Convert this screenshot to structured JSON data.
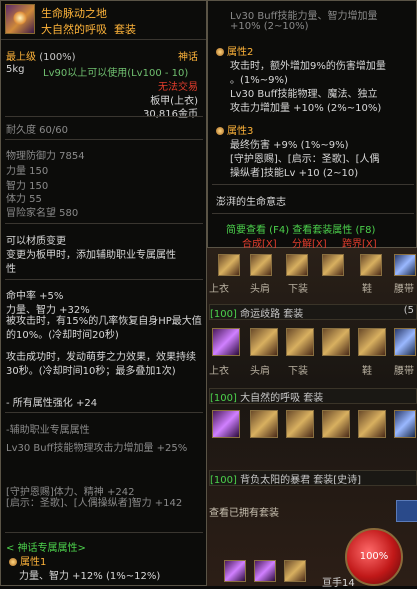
{
  "item": {
    "name": "生命脉动之地",
    "set_name": "大自然的呼吸",
    "set_tag": "套装",
    "max_level": "最上级",
    "max_level_pct": "(100%)",
    "rarity": "神话",
    "weight": "5kg",
    "level_req": "Lv90以上可以使用(Lv100 - 10)",
    "untradeable": "无法交易",
    "slot_type": "板甲(上衣)",
    "price": "30,816金币",
    "durability": "耐久度 60/60",
    "stats": [
      "物理防御力 7854",
      "力量 150",
      "智力 150",
      "体力 55",
      "冒险家名望 580"
    ],
    "convert_1": "可以材质变更",
    "convert_2": "变更为板甲时，添加辅助职业专属属性",
    "effects": [
      "命中率 +5%",
      "力量、智力 +32%",
      "被攻击时，有15%的几率恢复自身HP最大值的10%。(冷却时间20秒)"
    ],
    "effect2": "攻击成功时，发动萌芽之力效果，效果持续30秒。(冷却时间10秒；最多叠加1次)",
    "all_attr": "- 所有属性强化 +24",
    "aux_title": "-辅助职业专属属性",
    "aux_1": "Lv30 Buff技能物理攻击力增加量 +25%",
    "aux_2": "[守护恩赐]体力、精神 +242",
    "aux_3": "[启示：圣歌]、[人偶操纵者]智力 +142",
    "myth_title": "< 神话专属属性>",
    "myth_attr1_title": "属性1",
    "myth_attr1_value": "力量、智力 +12% (1%~12%)"
  },
  "right_tip": {
    "line0": "Lv30 Buff技能力量、智力增加量",
    "line0b": "+10% (2~10%)",
    "attr2_title": "属性2",
    "attr2_1": "攻击时，额外增加9%的伤害增加量",
    "attr2_2": "。(1%~9%)",
    "attr2_3": "Lv30 Buff技能物理、魔法、独立",
    "attr2_4": "攻击力增加量 +10% (2%~10%)",
    "attr3_title": "属性3",
    "attr3_1": "最终伤害 +9% (1%~9%)",
    "attr3_2": "[守护恩赐]、[启示：圣歌]、[人偶",
    "attr3_3": "操纵者]技能Lv +10 (2~10)",
    "flavor": "澎湃的生命意志",
    "links_1": "简要查看 (F4) 查看套装属性 (F8)",
    "btn_combine": "合成[X]",
    "btn_split": "分解[X]",
    "btn_cross": "跨界[X]"
  },
  "equipment": {
    "labels_row1": [
      "上衣",
      "头肩",
      "下装",
      "鞋",
      "腰带"
    ],
    "set1_level": "[100]",
    "set1_name": "命运歧路",
    "set1_tag": "套装",
    "set1_count": "(5",
    "labels_row2": [
      "上衣",
      "头肩",
      "下装",
      "鞋",
      "腰带"
    ],
    "set2_level": "[100]",
    "set2_name": "大自然的呼吸",
    "set2_tag": "套装",
    "set3_level": "[100]",
    "set3_name": "背负太阳的暴君",
    "set3_tag": "套装[史诗]",
    "view_owned": "查看已拥有套装",
    "hp_orb": "100%",
    "bottom_text": "亘手14"
  }
}
